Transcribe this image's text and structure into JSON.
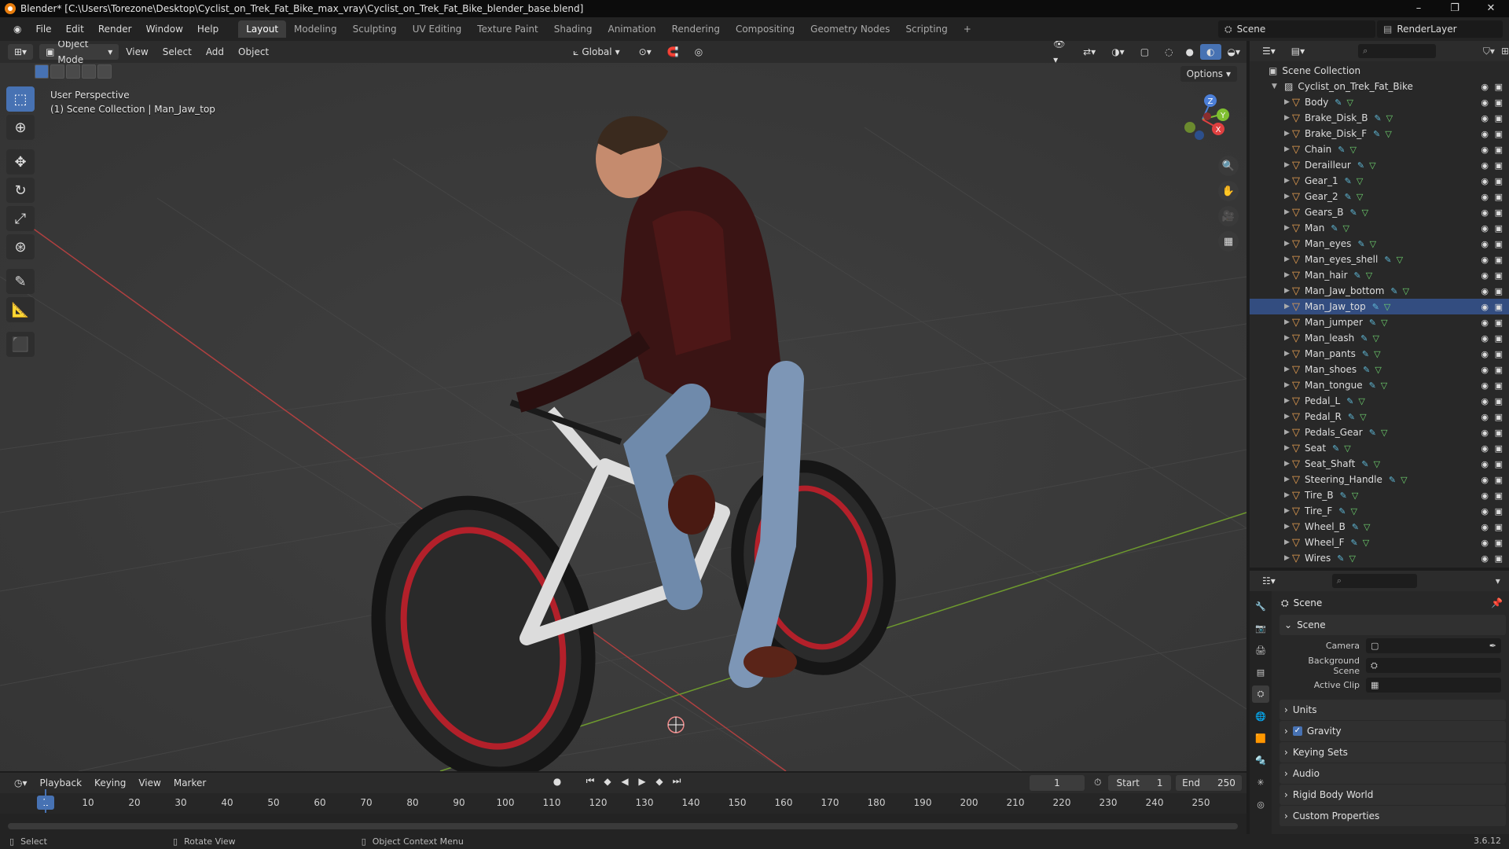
{
  "window": {
    "title": "Blender* [C:\\Users\\Torezone\\Desktop\\Cyclist_on_Trek_Fat_Bike_max_vray\\Cyclist_on_Trek_Fat_Bike_blender_base.blend]",
    "minimize": "–",
    "maximize": "❐",
    "close": "✕"
  },
  "menu": [
    "File",
    "Edit",
    "Render",
    "Window",
    "Help"
  ],
  "workspaces": [
    "Layout",
    "Modeling",
    "Sculpting",
    "UV Editing",
    "Texture Paint",
    "Shading",
    "Animation",
    "Rendering",
    "Compositing",
    "Geometry Nodes",
    "Scripting",
    "+"
  ],
  "scene_name": "Scene",
  "view_layer": "RenderLayer",
  "viewport": {
    "mode": "Object Mode",
    "menus": [
      "View",
      "Select",
      "Add",
      "Object"
    ],
    "transform_orientation": "Global",
    "options_label": "Options",
    "info_line1": "User Perspective",
    "info_line2": "(1) Scene Collection | Man_Jaw_top",
    "gizmo_x": "X",
    "gizmo_y": "Y",
    "gizmo_z": "Z"
  },
  "timeline": {
    "menus": [
      "Playback",
      "Keying",
      "View",
      "Marker"
    ],
    "current_frame": "1",
    "start_label": "Start",
    "start": "1",
    "end_label": "End",
    "end": "250",
    "ticks": [
      "10",
      "20",
      "30",
      "40",
      "50",
      "60",
      "70",
      "80",
      "90",
      "100",
      "110",
      "120",
      "130",
      "140",
      "150",
      "160",
      "170",
      "180",
      "190",
      "200",
      "210",
      "220",
      "230",
      "240",
      "250"
    ]
  },
  "status": {
    "select": "Select",
    "rotate": "Rotate View",
    "context": "Object Context Menu",
    "version": "3.6.12"
  },
  "outliner": {
    "root": "Scene Collection",
    "collection": "Cyclist_on_Trek_Fat_Bike",
    "selected": "Man_Jaw_top",
    "items": [
      "Body",
      "Brake_Disk_B",
      "Brake_Disk_F",
      "Chain",
      "Derailleur",
      "Gear_1",
      "Gear_2",
      "Gears_B",
      "Man",
      "Man_eyes",
      "Man_eyes_shell",
      "Man_hair",
      "Man_Jaw_bottom",
      "Man_Jaw_top",
      "Man_jumper",
      "Man_leash",
      "Man_pants",
      "Man_shoes",
      "Man_tongue",
      "Pedal_L",
      "Pedal_R",
      "Pedals_Gear",
      "Seat",
      "Seat_Shaft",
      "Steering_Handle",
      "Tire_B",
      "Tire_F",
      "Wheel_B",
      "Wheel_F",
      "Wires"
    ]
  },
  "properties": {
    "title": "Scene",
    "section_scene": "Scene",
    "camera_label": "Camera",
    "background_label": "Background Scene",
    "clip_label": "Active Clip",
    "sections": [
      "Units",
      "Gravity",
      "Keying Sets",
      "Audio",
      "Rigid Body World",
      "Custom Properties"
    ],
    "gravity_checked": "✓"
  }
}
